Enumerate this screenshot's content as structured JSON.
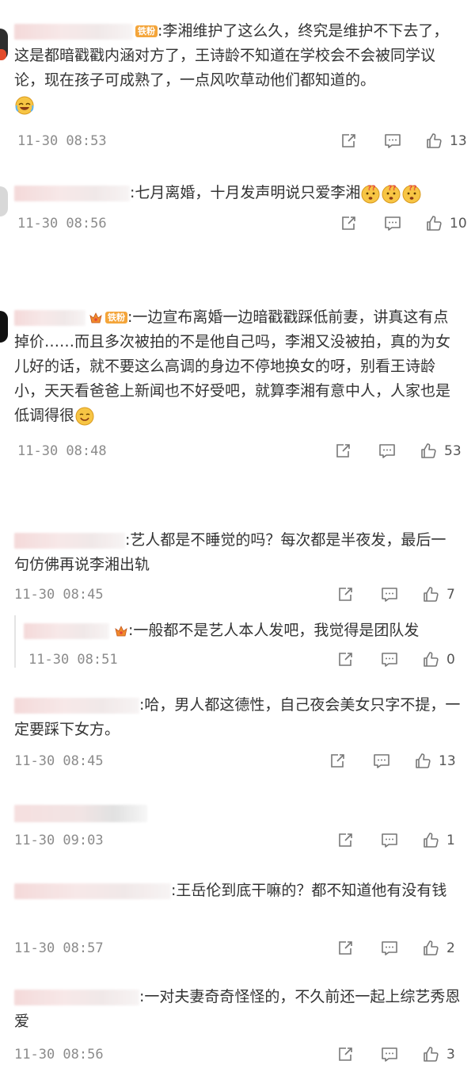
{
  "comments": [
    {
      "text": ":李湘维护了这么久，终究是维护不下去了，这是都暗戳戳内涵对方了，王诗龄不知道在学校会不会被同学议论，现在孩子可成熟了，一点风吹草动他们都知道的。",
      "badge": "铁粉",
      "time": "11-30 08:53",
      "likes": "13"
    },
    {
      "text": ":七月离婚，十月发声明说只爱李湘",
      "time": "11-30 08:56",
      "likes": "10"
    },
    {
      "text": ":一边宣布离婚一边暗戳戳踩低前妻，讲真这有点掉价……而且多次被拍的不是他自己吗，李湘又没被拍，真的为女儿好的话，就不要这么高调的身边不停地换女的呀，别看王诗龄小，天天看爸爸上新闻也不好受吧，就算李湘有意中人，人家也是低调得很",
      "badge": "铁粉",
      "time": "11-30 08:48",
      "likes": "53"
    },
    {
      "text": ":艺人都是不睡觉的吗？每次都是半夜发，最后一句仿佛再说李湘出轨",
      "time": "11-30 08:45",
      "likes": "7"
    },
    {
      "text": ":一般都不是艺人本人发吧，我觉得是团队发",
      "time": "11-30 08:51",
      "likes": "0"
    },
    {
      "text": ":哈，男人都这德性，自己夜会美女只字不提，一定要踩下女方。",
      "time": "11-30 08:45",
      "likes": "13"
    },
    {
      "text": "",
      "time": "11-30 09:03",
      "likes": "1"
    },
    {
      "text": ":王岳伦到底干嘛的？都不知道他有没有钱",
      "time": "11-30 08:57",
      "likes": "2"
    },
    {
      "text": ":一对夫妻奇奇怪怪的，不久前还一起上综艺秀恩爱",
      "time": "11-30 08:56",
      "likes": "3"
    }
  ],
  "icons": {
    "share": "share-icon",
    "comment": "comment-icon",
    "like": "thumbs-up-icon",
    "emoji_laugh": "laugh-cry-emoji",
    "emoji_question": "question-face-emoji",
    "emoji_smile": "smile-emoji",
    "crown": "crown-icon"
  },
  "colors": {
    "text": "#333333",
    "meta": "#8b8b8b",
    "badge": "#f4a53a"
  }
}
